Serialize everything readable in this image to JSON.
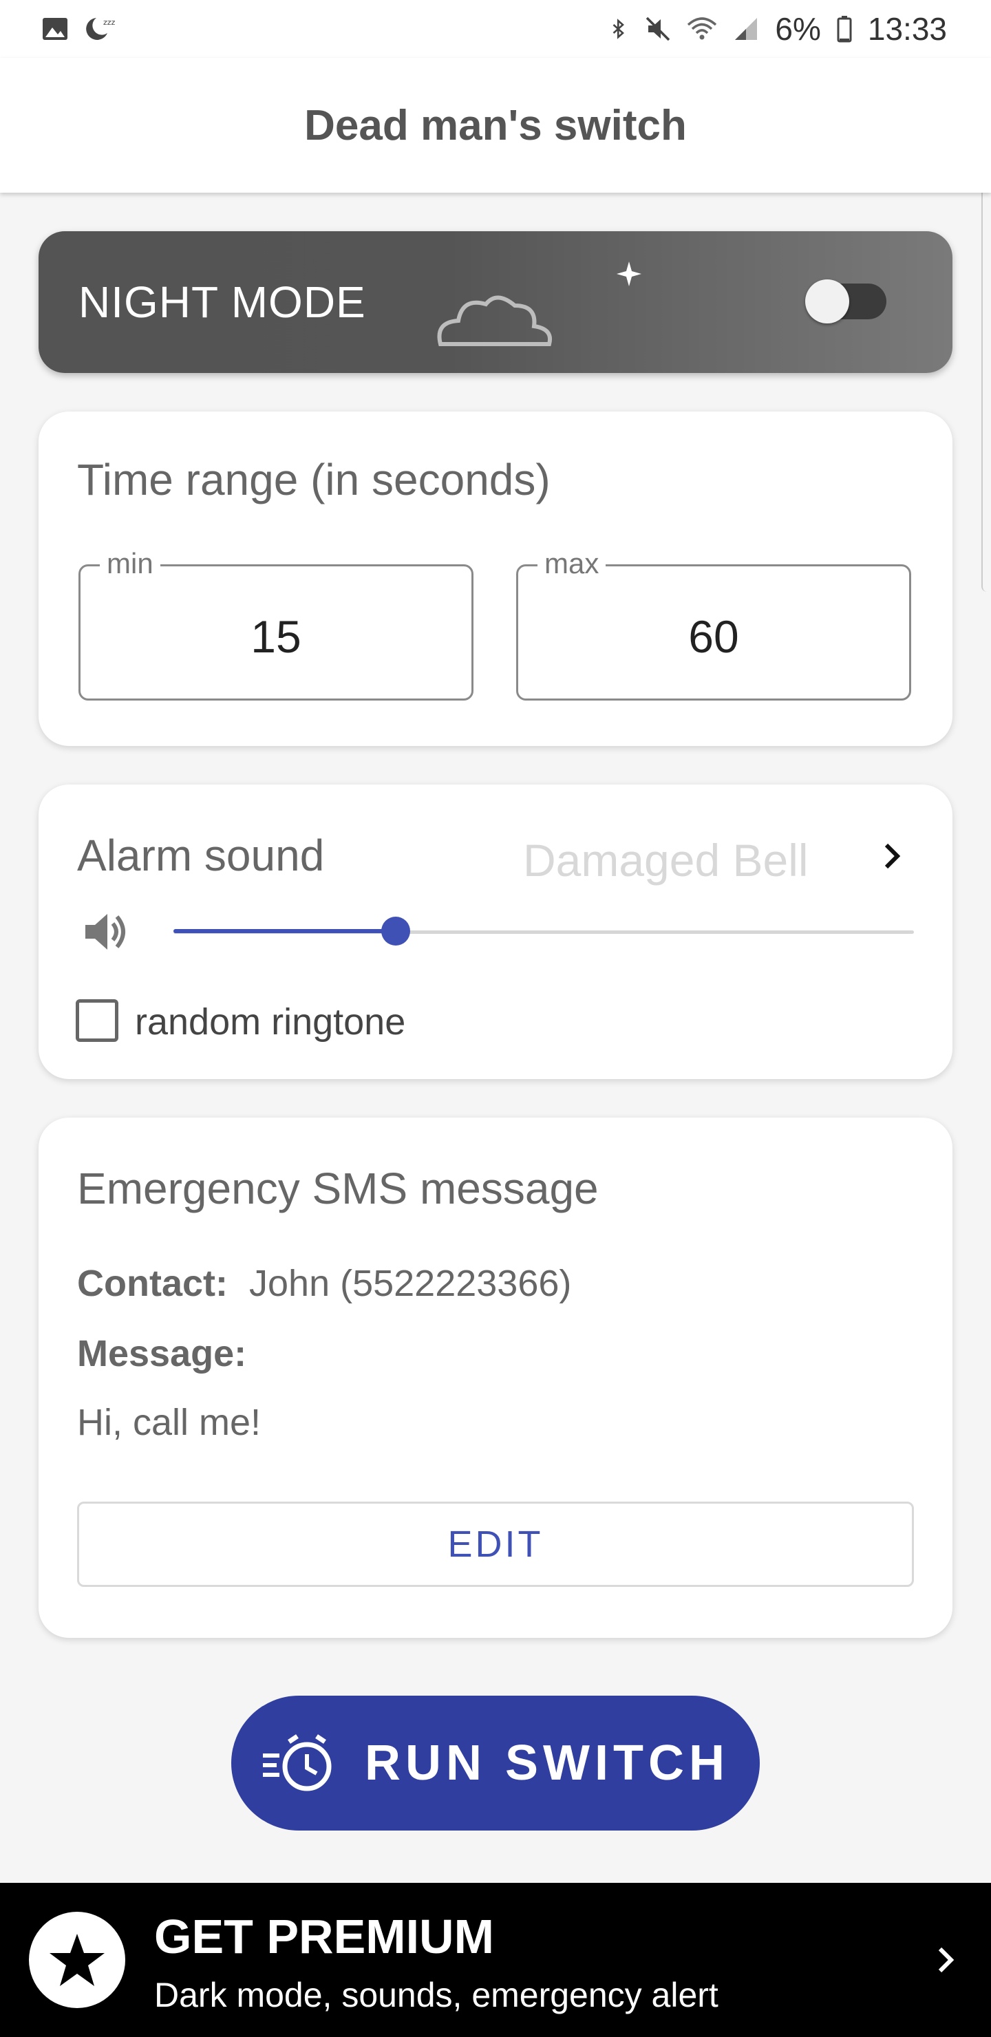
{
  "status_bar": {
    "battery_text": "6%",
    "time": "13:33",
    "left_icons": [
      "image-icon",
      "sleep-icon"
    ],
    "right_icons": [
      "bluetooth-icon",
      "mute-icon",
      "wifi-icon",
      "signal-icon",
      "battery-icon"
    ]
  },
  "app_bar": {
    "title": "Dead man's switch"
  },
  "night_mode": {
    "label": "NIGHT MODE",
    "enabled": false
  },
  "time_range": {
    "title": "Time range (in seconds)",
    "min_label": "min",
    "min_value": "15",
    "max_label": "max",
    "max_value": "60"
  },
  "alarm": {
    "title": "Alarm sound",
    "sound_name": "Damaged Bell",
    "volume_fraction": 0.3,
    "random_label": "random ringtone",
    "random_checked": false
  },
  "sms": {
    "title": "Emergency SMS message",
    "contact_label": "Contact:",
    "contact_value": "John (5522223366)",
    "message_label": "Message:",
    "message_value": "Hi, call me!",
    "edit_label": "EDIT"
  },
  "run_button": {
    "label": "RUN SWITCH"
  },
  "premium": {
    "title": "GET PREMIUM",
    "subtitle": "Dark mode, sounds, emergency alert"
  },
  "colors": {
    "accent": "#3f51b5",
    "run_button": "#303f9f",
    "banner": "#000000"
  }
}
